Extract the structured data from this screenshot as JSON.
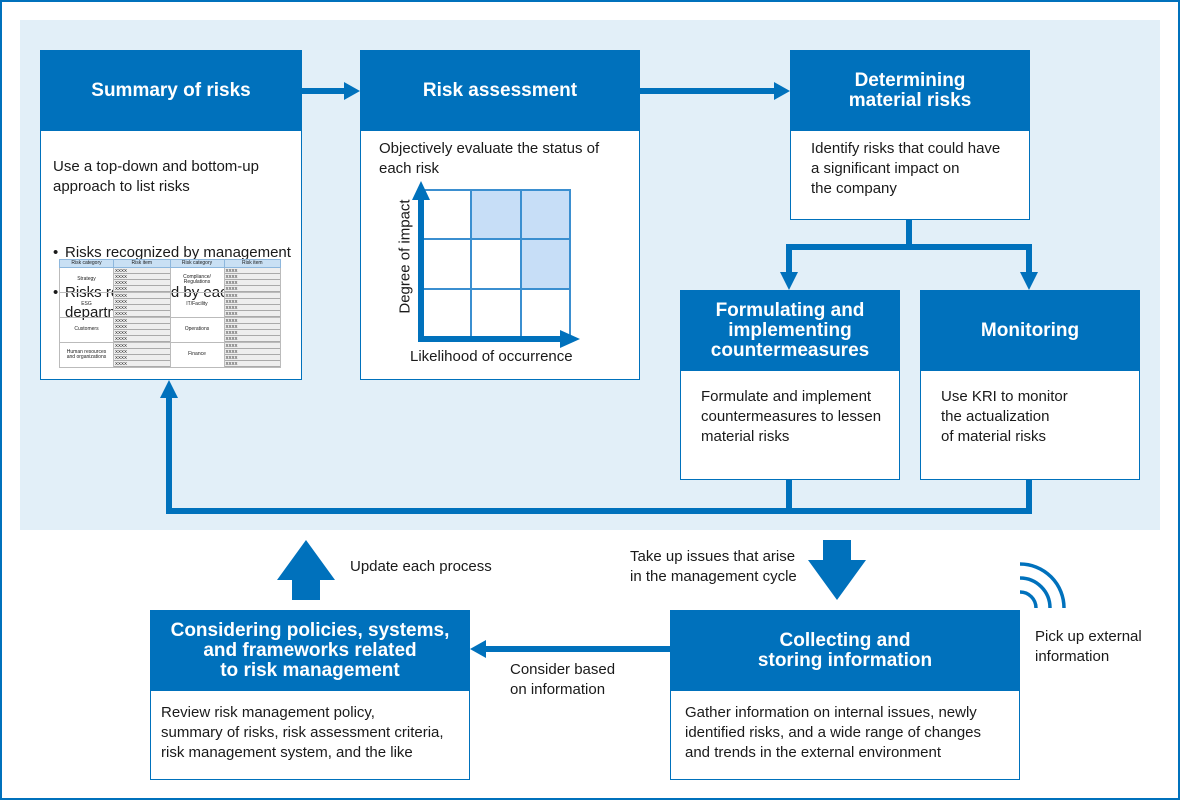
{
  "colors": {
    "primary": "#0071bc",
    "band": "#e2eff8",
    "highlight": "#c7def7"
  },
  "summary": {
    "title": "Summary of risks",
    "body": "Use a top-down and bottom-up\napproach to list risks",
    "bullets": [
      "Risks recognized by management",
      "Risks recognized by each\ndepartment"
    ],
    "table": {
      "headers": [
        "Risk category",
        "Risk item",
        "Risk category",
        "Risk item"
      ],
      "rows": [
        {
          "left": "Strategy",
          "right": "Compliance/\nRegulations"
        },
        {
          "left": "ESG",
          "right": "IT/Facility"
        },
        {
          "left": "Customers",
          "right": "Operations"
        },
        {
          "left": "Human resources\nand organizations",
          "right": "Finance"
        }
      ],
      "item_placeholder": "XXXX"
    }
  },
  "assessment": {
    "title": "Risk assessment",
    "body": "Objectively evaluate the status of\neach risk",
    "y_axis": "Degree of impact",
    "x_axis": "Likelihood of occurrence",
    "highlighted_cells": [
      "row1-col2",
      "row1-col3",
      "row2-col3"
    ]
  },
  "material": {
    "title": "Determining\nmaterial risks",
    "body": "Identify risks that could have\na significant impact on\nthe company"
  },
  "countermeasures": {
    "title": "Formulating and\nimplementing\ncountermeasures",
    "body": "Formulate and implement\ncountermeasures to lessen\nmaterial risks"
  },
  "monitoring": {
    "title": "Monitoring",
    "body": "Use KRI to monitor\nthe actualization\nof material risks"
  },
  "policies": {
    "title": "Considering policies, systems,\nand frameworks related\nto risk management",
    "body": "Review risk management policy,\nsummary of risks, risk assessment criteria,\nrisk management system, and the like"
  },
  "collecting": {
    "title": "Collecting and\nstoring information",
    "body": "Gather information on internal issues, newly\nidentified risks, and a wide range of changes\nand trends in the external environment"
  },
  "labels": {
    "update": "Update each process",
    "take_up": "Take up issues that arise\nin the management cycle",
    "consider": "Consider based\non information",
    "pick_up": "Pick up external\ninformation"
  }
}
